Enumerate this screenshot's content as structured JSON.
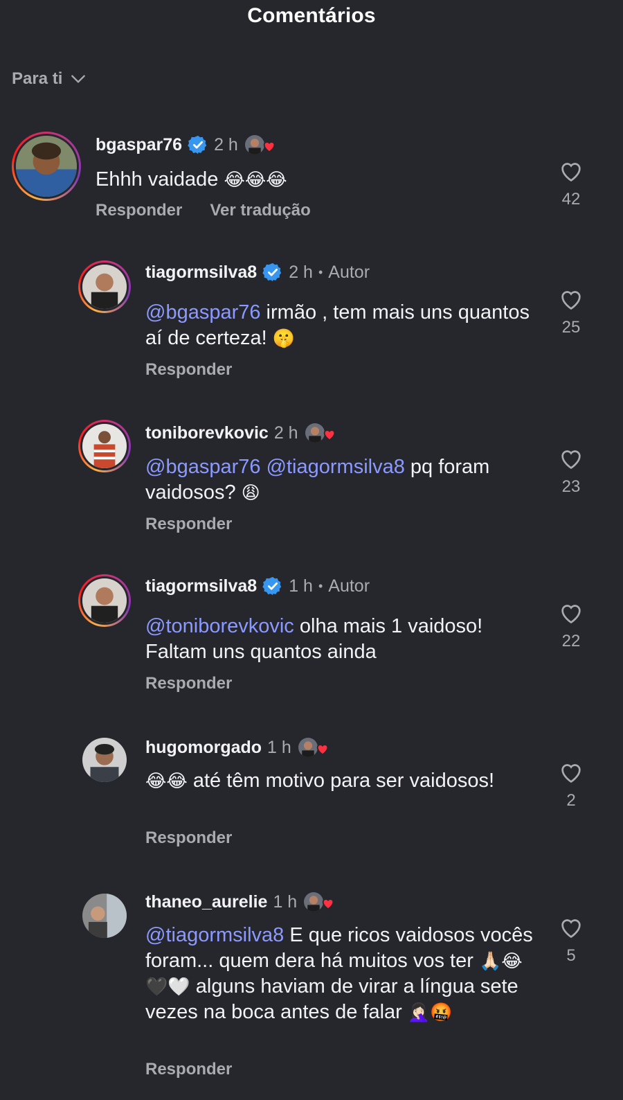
{
  "header": {
    "title": "Comentários"
  },
  "filter": {
    "label": "Para ti"
  },
  "actions": {
    "reply": "Responder",
    "translate": "Ver tradução"
  },
  "comments": [
    {
      "username": "bgaspar76",
      "verified": true,
      "time": "2 h",
      "author_label": "",
      "liked_by_creator": true,
      "segments": [
        {
          "t": "Ehhh vaidade "
        },
        {
          "t": "😂😂😂",
          "emoji": true
        }
      ],
      "likes": "42",
      "show_translate": true
    },
    {
      "username": "tiagormsilva8",
      "verified": true,
      "time": "2 h",
      "author_label": "Autor",
      "liked_by_creator": false,
      "segments": [
        {
          "t": "@bgaspar76",
          "mention": true
        },
        {
          "t": " irmão , tem mais uns quantos aí de certeza! "
        },
        {
          "t": "🤫",
          "emoji": true
        }
      ],
      "likes": "25",
      "show_translate": false
    },
    {
      "username": "toniborevkovic",
      "verified": false,
      "time": "2 h",
      "author_label": "",
      "liked_by_creator": true,
      "segments": [
        {
          "t": "@bgaspar76",
          "mention": true
        },
        {
          "t": " "
        },
        {
          "t": "@tiagormsilva8",
          "mention": true
        },
        {
          "t": " pq foram vaidosos? "
        },
        {
          "t": "😩",
          "emoji": true
        }
      ],
      "likes": "23",
      "show_translate": false
    },
    {
      "username": "tiagormsilva8",
      "verified": true,
      "time": "1 h",
      "author_label": "Autor",
      "liked_by_creator": false,
      "segments": [
        {
          "t": "@toniborevkovic",
          "mention": true
        },
        {
          "t": " olha mais 1 vaidoso! Faltam uns quantos ainda"
        }
      ],
      "likes": "22",
      "show_translate": false
    },
    {
      "username": "hugomorgado",
      "verified": false,
      "time": "1 h",
      "author_label": "",
      "liked_by_creator": true,
      "segments": [
        {
          "t": "😂😂",
          "emoji": true
        },
        {
          "t": " até têm motivo para ser vaidosos!"
        }
      ],
      "likes": "2",
      "show_translate": false
    },
    {
      "username": "thaneo_aurelie",
      "verified": false,
      "time": "1 h",
      "author_label": "",
      "liked_by_creator": true,
      "segments": [
        {
          "t": "@tiagormsilva8",
          "mention": true
        },
        {
          "t": " E que ricos vaidosos vocês foram... quem dera há muitos vos ter "
        },
        {
          "t": "🙏🏻😂🖤🤍",
          "emoji": true
        },
        {
          "t": " alguns haviam de virar a língua sete vezes na boca antes de falar "
        },
        {
          "t": "🤦🏻‍♀️🤬",
          "emoji": true
        }
      ],
      "likes": "5",
      "show_translate": false
    }
  ],
  "colors": {
    "background": "#25272d",
    "mention": "#8c9aff",
    "secondary_text": "#a9abb1",
    "verified": "#3797f0",
    "heart": "#ff3040"
  }
}
